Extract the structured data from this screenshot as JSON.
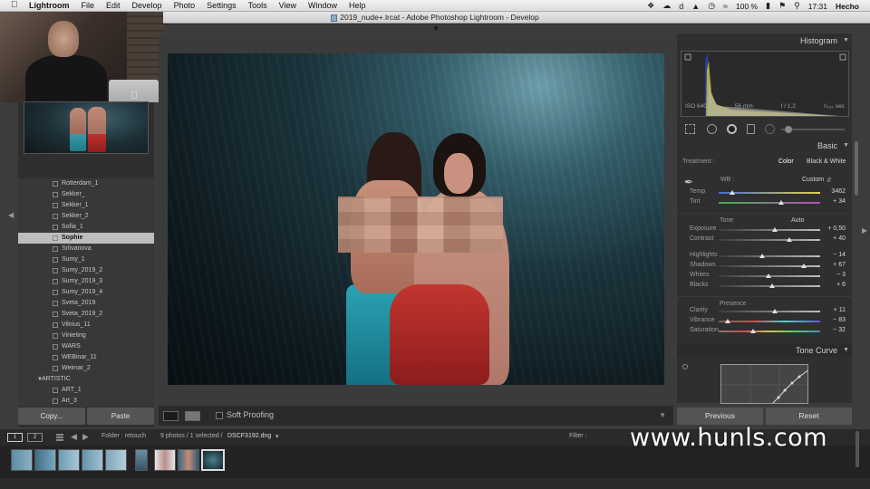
{
  "menubar": {
    "app_name": "Lightroom",
    "items": [
      "File",
      "Edit",
      "Develop",
      "Photo",
      "Settings",
      "Tools",
      "View",
      "Window",
      "Help"
    ],
    "battery": "100 %",
    "time": "17:31",
    "user": "Hecho"
  },
  "window": {
    "title": "2019_nude+.lrcat - Adobe Photoshop Lightroom - Develop"
  },
  "left_panel": {
    "folders": [
      {
        "label": "Rotterdam_1",
        "selected": false
      },
      {
        "label": "Sekker_",
        "selected": false
      },
      {
        "label": "Sekker_1",
        "selected": false
      },
      {
        "label": "Sekker_2",
        "selected": false
      },
      {
        "label": "Sofia_1",
        "selected": false
      },
      {
        "label": "Sophie",
        "selected": true
      },
      {
        "label": "Srlivanova",
        "selected": false
      },
      {
        "label": "Sumy_1",
        "selected": false
      },
      {
        "label": "Sumy_2019_2",
        "selected": false
      },
      {
        "label": "Sumy_2019_3",
        "selected": false
      },
      {
        "label": "Sumy_2019_4",
        "selected": false
      },
      {
        "label": "Sveta_2019",
        "selected": false
      },
      {
        "label": "Sveta_2019_2",
        "selected": false
      },
      {
        "label": "Vilnius_11",
        "selected": false
      },
      {
        "label": "Vinieting",
        "selected": false
      },
      {
        "label": "WARS",
        "selected": false
      },
      {
        "label": "WEBinar_11",
        "selected": false
      },
      {
        "label": "Weimar_2",
        "selected": false
      }
    ],
    "group": "ARTISTIC",
    "group_items": [
      "ART_1",
      "Art_3"
    ],
    "copy_button": "Copy...",
    "paste_button": "Paste"
  },
  "toolbar": {
    "soft_proofing": "Soft Proofing"
  },
  "right_panel": {
    "histogram_title": "Histogram",
    "hist_info": {
      "iso": "ISO 640",
      "focal": "56 mm",
      "aperture": "f / 1,2",
      "shutter": "¹⁄₄₀₀ sec"
    },
    "basic_title": "Basic",
    "treatment_label": "Treatment :",
    "treatment_color": "Color",
    "treatment_bw": "Black & White",
    "wb_label": "WB :",
    "wb_value": "Custom",
    "tone_label": "Tone",
    "tone_auto": "Auto",
    "presence_label": "Presence",
    "sliders": [
      {
        "name": "Temp",
        "value": "3462",
        "pos": 0.13,
        "track": "temp"
      },
      {
        "name": "Tint",
        "value": "+ 34",
        "pos": 0.62,
        "track": "tint"
      },
      {
        "name": "Exposure",
        "value": "+ 0,50",
        "pos": 0.55,
        "track": "gray"
      },
      {
        "name": "Contrast",
        "value": "+ 40",
        "pos": 0.7,
        "track": "gray"
      },
      {
        "name": "Highlights",
        "value": "− 14",
        "pos": 0.43,
        "track": "gray"
      },
      {
        "name": "Shadows",
        "value": "+ 67",
        "pos": 0.84,
        "track": "gray"
      },
      {
        "name": "Whites",
        "value": "− 3",
        "pos": 0.49,
        "track": "gray"
      },
      {
        "name": "Blacks",
        "value": "+ 6",
        "pos": 0.53,
        "track": "gray"
      },
      {
        "name": "Clarity",
        "value": "+ 11",
        "pos": 0.55,
        "track": "gray"
      },
      {
        "name": "Vibrance",
        "value": "− 83",
        "pos": 0.09,
        "track": "vib"
      },
      {
        "name": "Saturation",
        "value": "− 32",
        "pos": 0.34,
        "track": "sat"
      }
    ],
    "tone_curve_title": "Tone Curve",
    "previous_button": "Previous",
    "reset_button": "Reset"
  },
  "filmbar": {
    "monitor1": "1",
    "monitor2": "2",
    "folder": "Folder : retouch",
    "count": "9 photos / 1 selected /",
    "filename": "DSCF3192.dng",
    "filter": "Filter :"
  },
  "watermark": "www.hunls.com",
  "colors": {
    "panel_bg": "#2f2f2f",
    "selected_row": "#bdbdbd",
    "button_bg": "#545454"
  }
}
